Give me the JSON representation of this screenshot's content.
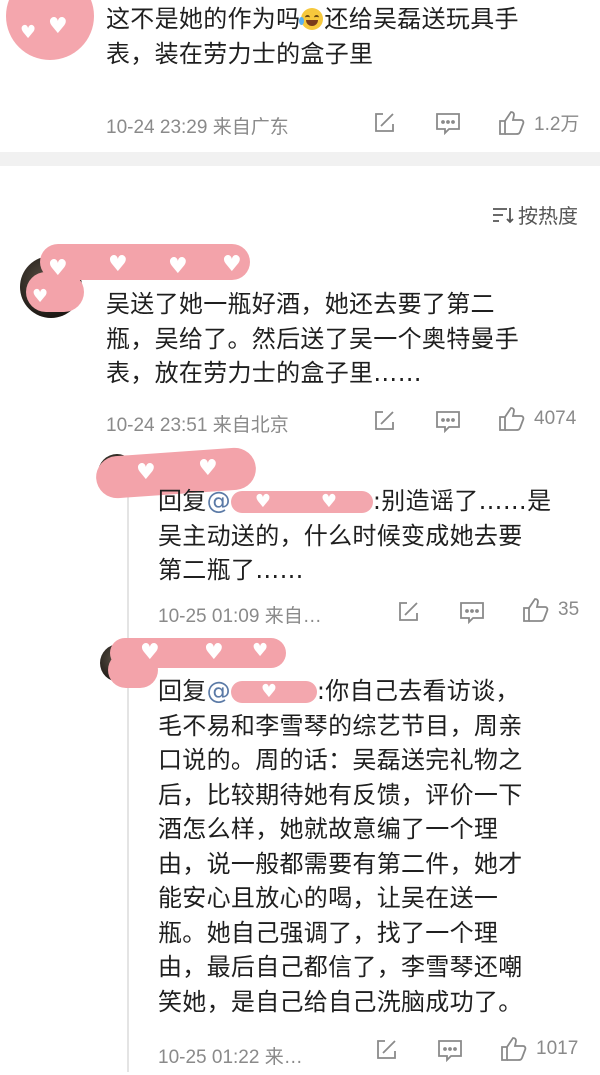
{
  "colors": {
    "mask_pink": "#f3a3aa",
    "meta_gray": "#8a8a8a",
    "mention_blue": "#5b7aa6"
  },
  "top_comment": {
    "text_line1_a": "这不是她的作为吗",
    "text_line1_b": "还给吴磊送玩具手",
    "text_line2": "表，装在劳力士的盒子里",
    "emoji_icon": "laughing-crying-emoji",
    "meta": "10-24 23:29 来自广东",
    "likes": "1.2万"
  },
  "sort_button": {
    "label": "按热度",
    "icon": "sort-lines-icon"
  },
  "comment1": {
    "lines": [
      "吴送了她一瓶好酒，她还去要了第二",
      "瓶，吴给了。然后送了吴一个奥特曼手",
      "表，放在劳力士的盒子里……"
    ],
    "meta": "10-24 23:51 来自北京",
    "likes": "4074"
  },
  "reply1": {
    "prefix": "回复",
    "at": "@",
    "after_mask": ":别造谣了……是",
    "lines": [
      "吴主动送的，什么时候变成她去要",
      "第二瓶了……"
    ],
    "meta": "10-25 01:09 来自…",
    "likes": "35"
  },
  "reply2": {
    "prefix": "回复",
    "at": "@",
    "after_mask": ":你自己去看访谈，",
    "lines": [
      "毛不易和李雪琴的综艺节目，周亲",
      "口说的。周的话：吴磊送完礼物之",
      "后，比较期待她有反馈，评价一下",
      "酒怎么样，她就故意编了一个理",
      "由，说一般都需要有第二件，她才",
      "能安心且放心的喝，让吴在送一",
      "瓶。她自己强调了，找了一个理",
      "由，最后自己都信了，李雪琴还嘲",
      "笑她，是自己给自己洗脑成功了。"
    ],
    "meta": "10-25 01:22 来…",
    "likes": "1017"
  }
}
